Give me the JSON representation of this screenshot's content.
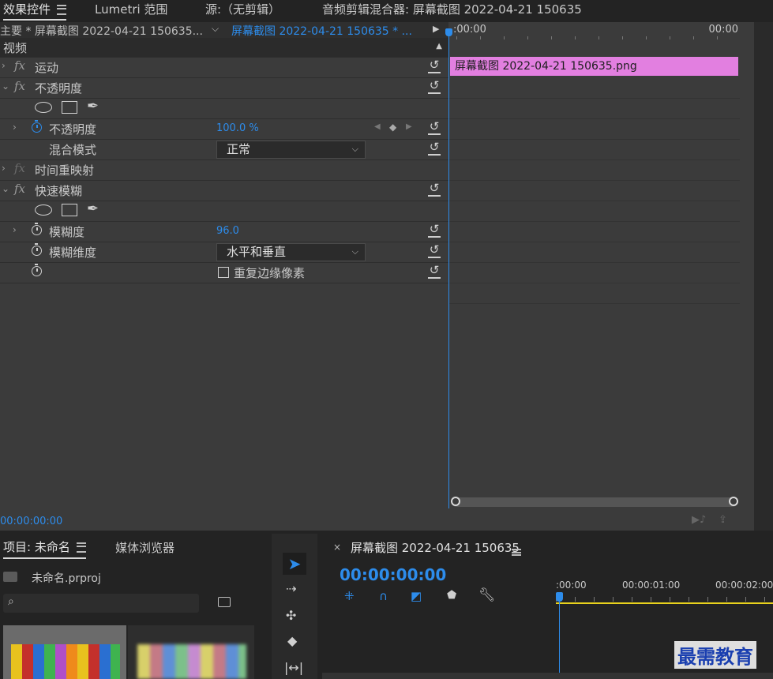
{
  "tabs": [
    {
      "label": "效果控件"
    },
    {
      "label": "Lumetri 范围"
    },
    {
      "label": "源:（无剪辑）"
    },
    {
      "label": "音频剪辑混合器: 屏幕截图 2022-04-21 150635"
    }
  ],
  "effects": {
    "master_clip": "主要 * 屏幕截图 2022-04-21 150635...",
    "sequence_clip": "屏幕截图 2022-04-21 150635 * ...",
    "section_video": "视频",
    "rows": {
      "motion": "运动",
      "opacity_group": "不透明度",
      "opacity_param": "不透明度",
      "opacity_value": "100.0 %",
      "blend_mode": "混合模式",
      "blend_mode_value": "正常",
      "time_remap": "时间重映射",
      "fast_blur": "快速模糊",
      "blurriness": "模糊度",
      "blurriness_value": "96.0",
      "blur_dimensions": "模糊维度",
      "blur_dimensions_value": "水平和垂直",
      "repeat_edge": "重复边缘像素"
    },
    "timeline": {
      "start": ":00:00",
      "end": "00:00",
      "clip_name": "屏幕截图 2022-04-21 150635.png"
    },
    "current_time": "00:00:00:00"
  },
  "project": {
    "tab_project": "项目: 未命名",
    "tab_media": "媒体浏览器",
    "file_name": "未命名.prproj",
    "search_placeholder": ""
  },
  "sequence": {
    "title": "屏幕截图 2022-04-21 150635",
    "timecode": "00:00:00:00",
    "ruler": [
      ":00:00",
      "00:00:01:00",
      "00:00:02:00"
    ]
  },
  "watermark": "最需教育",
  "colors": {
    "accent_blue": "#2d8ceb",
    "clip_pink": "#e27fe0",
    "panel_bg": "#3b3b3b",
    "app_bg": "#232323",
    "yellow": "#e8d21d"
  }
}
